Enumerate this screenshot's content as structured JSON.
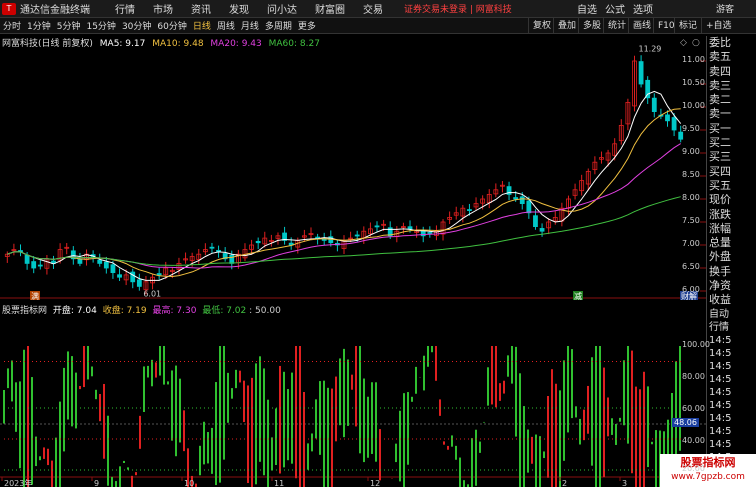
{
  "topbar": {
    "app_title": "通达信金融终端",
    "menu": [
      "行情",
      "市场",
      "资讯",
      "发现",
      "问小达",
      "财富圈",
      "交易"
    ],
    "notice": "证券交易未登录 | 网富科技",
    "right_menu": [
      "自选",
      "公式",
      "选项"
    ],
    "user": "游客"
  },
  "toolbar": {
    "periods": [
      "分时",
      "1分钟",
      "5分钟",
      "15分钟",
      "30分钟",
      "60分钟",
      "日线",
      "周线",
      "月线",
      "多周期",
      "更多"
    ],
    "active_period": "日线",
    "right_buttons": [
      "复权",
      "叠加",
      "多股",
      "统计",
      "画线",
      "F10",
      "标记",
      "+自选"
    ]
  },
  "main_header": {
    "stock_title": "网富科技(日线 前复权)",
    "ma5": "MA5: 9.17",
    "ma10": "MA10: 9.48",
    "ma20": "MA20: 9.43",
    "ma60": "MA60: 8.27"
  },
  "indicator_header": {
    "name": "股票指标网",
    "open": "开盘: 7.04",
    "close": "收盘: 7.19",
    "high": "最高: 7.30",
    "low": "最低: 7.02",
    "extra": ": 50.00"
  },
  "price_axis": [
    "11.00",
    "10.50",
    "10.00",
    "9.50",
    "9.00",
    "8.50",
    "8.00",
    "7.50",
    "7.00",
    "6.50",
    "6.00"
  ],
  "osc_axis": [
    "100.00",
    "80.00",
    "60.00",
    "40.00",
    "20.00"
  ],
  "osc_current": "48.06",
  "annotations": {
    "high": "11.29",
    "low": "6.01",
    "tag_1": "满",
    "tag_2": "减",
    "tag_3": "财解"
  },
  "date_axis": [
    "2023年",
    "9",
    "10",
    "11",
    "12",
    "2",
    "3"
  ],
  "side_panel": [
    "委比",
    "卖五",
    "卖四",
    "卖三",
    "卖二",
    "卖一",
    "买一",
    "买二",
    "买三",
    "买四",
    "买五",
    "现价",
    "涨跌",
    "涨幅",
    "总量",
    "外盘",
    "换手",
    "净资",
    "收益"
  ],
  "side_panel_lower": [
    "自动",
    "行情",
    "14:5",
    "14:5",
    "14:5",
    "14:5",
    "14:5",
    "14:5",
    "14:5",
    "14:5",
    "14:5",
    "14:5"
  ],
  "watermark": {
    "line1": "股票指标网",
    "line2": "www.7gpzb.com"
  },
  "colors": {
    "up": "#e02020",
    "down": "#00c8c8",
    "ma5": "#ffffff",
    "ma10": "#f0c040",
    "ma20": "#e040e0",
    "ma60": "#40c040",
    "osc_green": "#30c030",
    "osc_red": "#e02020"
  }
}
